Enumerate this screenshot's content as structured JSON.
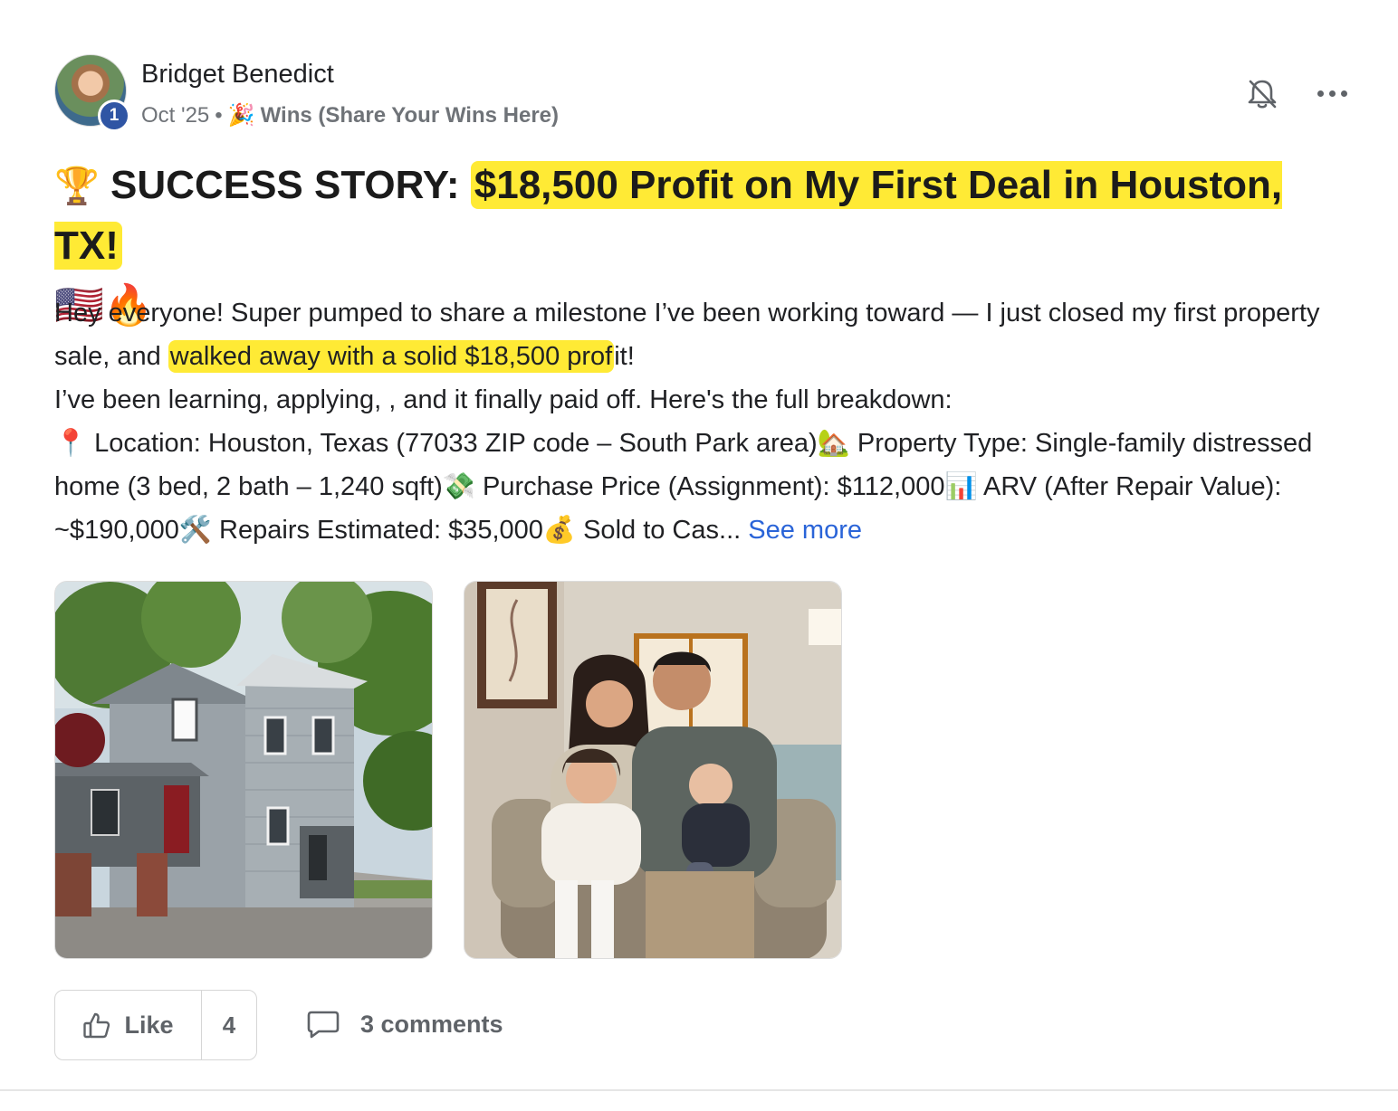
{
  "post": {
    "author": "Bridget Benedict",
    "level": "1",
    "date": "Oct '25",
    "separator": "•",
    "category_emoji": "🎉",
    "category": "Wins (Share Your Wins Here)",
    "title_emoji": "🏆",
    "title_prefix": "SUCCESS STORY: ",
    "title_highlight": "$18,500 Profit on My First Deal in Houston, TX!",
    "title_suffix_emoji": "🇺🇸🔥",
    "body": {
      "p1_start": "Hey everyone! Super pumped to share a milestone I’ve been working toward — I just closed my first property sale, and ",
      "p1_highlight": "walked away with a solid $18,500 prof",
      "p1_end": "it!",
      "p2": "I’ve been learning, applying, , and it finally paid off. Here's the full breakdown:",
      "p3": "📍 Location: Houston, Texas (77033 ZIP code – South Park area)🏡 Property Type: Single-family distressed home (3 bed, 2 bath – 1,240 sqft)💸 Purchase Price (Assignment): $112,000📊 ARV (After Repair Value): ~$190,000🛠️ Repairs Estimated: $35,000💰 Sold to Cas...",
      "see_more": "See more"
    },
    "images": [
      {
        "icon": "house-photo"
      },
      {
        "icon": "family-photo"
      }
    ],
    "actions": {
      "like_label": "Like",
      "like_count": "4",
      "comments_label": "3 comments"
    }
  },
  "colors": {
    "highlight": "#ffea35",
    "link": "#2a64d8",
    "level_badge": "#2f55a4",
    "muted_text": "#6f7378"
  }
}
